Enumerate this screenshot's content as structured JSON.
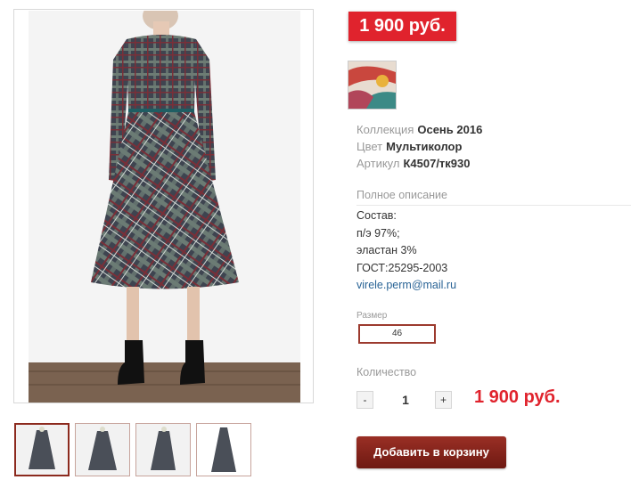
{
  "product": {
    "price_badge": "1 900 руб.",
    "color_swatch": "color-swatch-multicolor",
    "properties": [
      {
        "label": "Коллекция",
        "value": "Осень 2016"
      },
      {
        "label": "Цвет",
        "value": "Мультиколор"
      },
      {
        "label": "Артикул",
        "value": "К4507/тк930"
      }
    ]
  },
  "description": {
    "heading": "Полное описание",
    "lines": [
      "Состав:",
      "п/э 97%;",
      "эластан 3%",
      "ГОСТ:25295-2003"
    ],
    "email": "virele.perm@mail.ru"
  },
  "size": {
    "label": "Размер",
    "selected": "46"
  },
  "quantity": {
    "label": "Количество",
    "minus": "-",
    "value": "1",
    "plus": "+",
    "total": "1 900 руб."
  },
  "cart": {
    "add_label": "Добавить в корзину"
  },
  "gallery": {
    "thumbnails": [
      "thumb-front",
      "thumb-front-2",
      "thumb-side",
      "thumb-back"
    ],
    "active": 0
  },
  "colors": {
    "accent_red": "#e0232d",
    "button_dark_red": "#7e2018",
    "link_blue": "#2a6496",
    "muted_text": "#999999"
  }
}
